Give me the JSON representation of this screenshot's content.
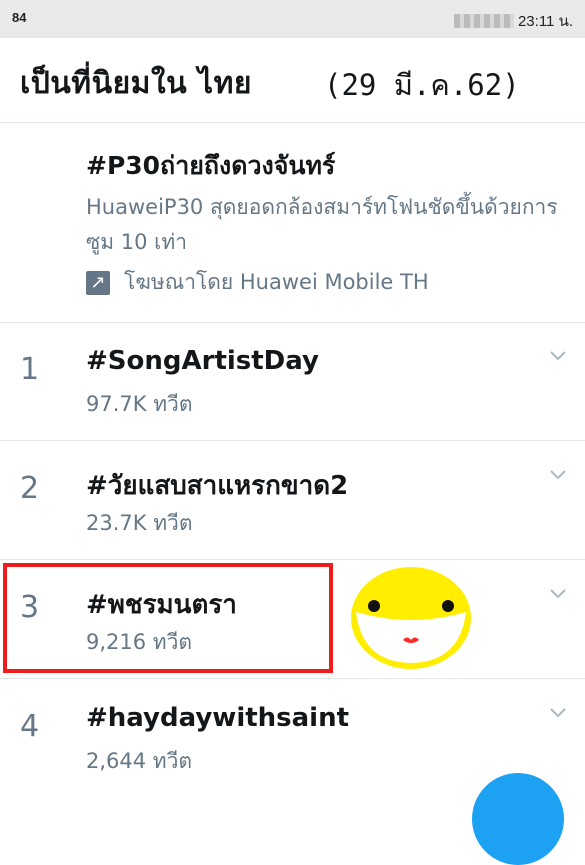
{
  "status_bar": {
    "left_text": "84",
    "time": "23:11",
    "suffix": "น."
  },
  "header": {
    "title": "เป็นที่นิยมใน ไทย",
    "date": "(29 มี.ค.62)"
  },
  "promoted": {
    "hashtag": "#P30ถ่ายถึงดวงจันทร์",
    "description": "HuaweiP30 สุดยอดกล้องสมาร์ทโฟนชัดขึ้นด้วยการซูม 10 เท่า",
    "sponsor": "โฆษณาโดย Huawei Mobile TH"
  },
  "trends": [
    {
      "rank": "1",
      "name": "#SongArtistDay",
      "count": "97.7K ทวีต"
    },
    {
      "rank": "2",
      "name": "#วัยแสบสาแหรกขาด2",
      "count": "23.7K ทวีต"
    },
    {
      "rank": "3",
      "name": "#พชรมนตรา",
      "count": "9,216 ทวีต"
    },
    {
      "rank": "4",
      "name": "#haydaywithsaint",
      "count": "2,644 ทวีต"
    }
  ],
  "colors": {
    "accent": "#1da1f2",
    "highlight": "#ef1c1c",
    "smiley": "#ffee00",
    "muted": "#657786"
  },
  "icons": {
    "promoted": "arrow-up-right-icon",
    "expand": "chevron-down-icon",
    "fab": "compose-icon"
  }
}
